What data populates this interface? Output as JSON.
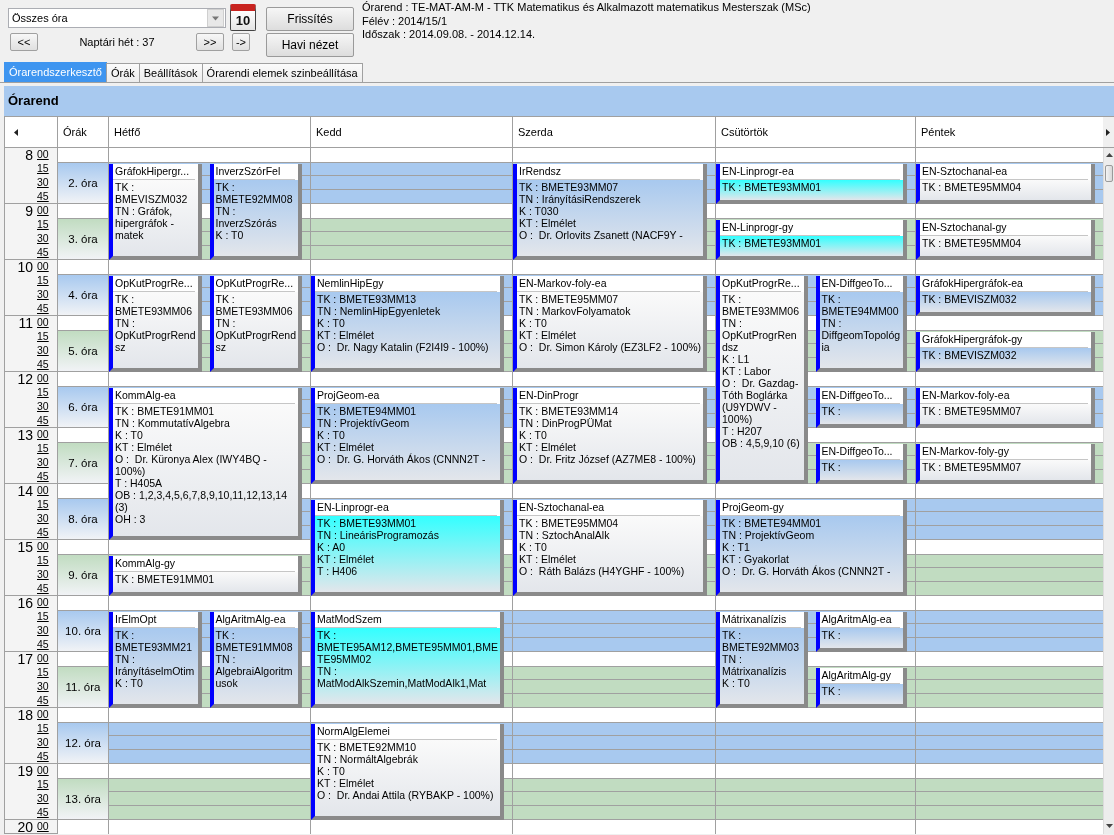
{
  "toolbar": {
    "filter_dropdown": {
      "value": "Összes óra"
    },
    "calendar_button": {
      "label": "10"
    },
    "prev_week_button": "<<",
    "week": "Naptári hét : 37",
    "next_week_button": ">>",
    "go_button": "->",
    "refresh_button": "Frissítés",
    "month_view_button": "Havi nézet"
  },
  "info": [
    "Órarend : TE-MAT-AM-M - TTK Matematikus és Alkalmazott matematikus Mesterszak (MSc)",
    "Félév : 2014/15/1",
    "Időszak : 2014.09.08. - 2014.12.14."
  ],
  "tabs": [
    {
      "label": "Órarendszerkesztő",
      "selected": true
    },
    {
      "label": "Órák",
      "selected": false
    },
    {
      "label": "Beállítások",
      "selected": false
    },
    {
      "label": "Órarendi elemek szinbeállítása",
      "selected": false
    }
  ],
  "panel": {
    "title": "Órarend"
  },
  "timetable": {
    "period_header": "Órák",
    "hours": [
      {
        "hour": "8",
        "minutes": [
          "00",
          "15",
          "30",
          "45"
        ],
        "period": {
          "label": "2. óra",
          "color": "#a8c9ef"
        }
      },
      {
        "hour": "9",
        "minutes": [
          "00",
          "15",
          "30",
          "45"
        ],
        "period": {
          "label": "3. óra",
          "color": "#c1dcc1"
        }
      },
      {
        "hour": "10",
        "minutes": [
          "00",
          "15",
          "30",
          "45"
        ],
        "period": {
          "label": "4. óra",
          "color": "#a8c9ef"
        }
      },
      {
        "hour": "11",
        "minutes": [
          "00",
          "15",
          "30",
          "45"
        ],
        "period": {
          "label": "5. óra",
          "color": "#c1dcc1"
        }
      },
      {
        "hour": "12",
        "minutes": [
          "00",
          "15",
          "30",
          "45"
        ],
        "period": {
          "label": "6. óra",
          "color": "#a8c9ef"
        }
      },
      {
        "hour": "13",
        "minutes": [
          "00",
          "15",
          "30",
          "45"
        ],
        "period": {
          "label": "7. óra",
          "color": "#c1dcc1"
        }
      },
      {
        "hour": "14",
        "minutes": [
          "00",
          "15",
          "30",
          "45"
        ],
        "period": {
          "label": "8. óra",
          "color": "#a8c9ef"
        }
      },
      {
        "hour": "15",
        "minutes": [
          "00",
          "15",
          "30",
          "45"
        ],
        "period": {
          "label": "9. óra",
          "color": "#c1dcc1"
        }
      },
      {
        "hour": "16",
        "minutes": [
          "00",
          "15",
          "30",
          "45"
        ],
        "period": {
          "label": "10. óra",
          "color": "#a8c9ef"
        }
      },
      {
        "hour": "17",
        "minutes": [
          "00",
          "15",
          "30",
          "45"
        ],
        "period": {
          "label": "11. óra",
          "color": "#c1dcc1"
        }
      },
      {
        "hour": "18",
        "minutes": [
          "00",
          "15",
          "30",
          "45"
        ],
        "period": {
          "label": "12. óra",
          "color": "#a8c9ef"
        }
      },
      {
        "hour": "19",
        "minutes": [
          "00",
          "15",
          "30",
          "45"
        ],
        "period": {
          "label": "13. óra",
          "color": "#c1dcc1"
        }
      },
      {
        "hour": "20",
        "minutes": [
          "00"
        ]
      }
    ],
    "days": [
      {
        "name": "Hétfő",
        "periods": [
          {
            "kind": "booked",
            "cards": [
              {
                "title": "GráfokHipergr...",
                "continued": false,
                "color": "#fafafa",
                "details": [
                  "TK : BMEVISZM032",
                  "TN : Gráfok, hipergráfok - matek"
                ]
              },
              {
                "title": "InverzSzórFel",
                "continued": false,
                "color": "#a8c9ef",
                "details": [
                  "TK : BMETE92MM08",
                  "TN : InverzSzórás",
                  "K : T0"
                ]
              }
            ]
          },
          {
            "kind": "booked",
            "cards": [
              {
                "continued": true
              },
              {
                "continued": true
              }
            ]
          },
          {
            "kind": "booked",
            "cards": [
              {
                "title": "OpKutProgrRe...",
                "continued": false,
                "color": "#fafafa",
                "details": [
                  "TK : BMETE93MM06",
                  "TN : OpKutProgrRendsz"
                ]
              },
              {
                "title": "OpKutProgrRe...",
                "continued": false,
                "color": "#fafafa",
                "details": [
                  "TK : BMETE93MM06",
                  "TN : OpKutProgrRendsz"
                ]
              }
            ]
          },
          {
            "kind": "booked",
            "cards": [
              {
                "continued": true
              },
              {
                "continued": true
              }
            ]
          },
          {
            "kind": "booked",
            "cards": [
              {
                "title": "KommAlg-ea",
                "continued": false,
                "color": "#fafafa",
                "details": [
                  "TK : BMETE91MM01",
                  "TN : KommutatívAlgebra",
                  "K : T0",
                  "KT : Elmélet",
                  "O :  Dr. Küronya Alex (IWY4BQ - 100%)",
                  "T : H405A",
                  "OB : 1,2,3,4,5,6,7,8,9,10,11,12,13,14 (3)",
                  "OH : 3"
                ]
              }
            ]
          },
          {
            "kind": "booked",
            "cards": [
              {
                "continued": true
              }
            ]
          },
          {
            "kind": "booked",
            "cards": [
              {
                "continued": true
              }
            ]
          },
          {
            "kind": "booked",
            "cards": [
              {
                "title": "KommAlg-gy",
                "continued": false,
                "color": "#fafafa",
                "details": [
                  "TK : BMETE91MM01"
                ]
              }
            ]
          },
          {
            "kind": "booked",
            "cards": [
              {
                "title": "IrElmOpt",
                "continued": false,
                "color": "#a8c9ef",
                "details": [
                  "TK : BMETE93MM21",
                  "TN : IrányításelmOtim",
                  "K : T0"
                ]
              },
              {
                "title": "AlgAritmAlg-ea",
                "continued": false,
                "color": "#a8c9ef",
                "details": [
                  "TK : BMETE91MM08",
                  "TN : AlgebraiAlgoritmusok"
                ]
              }
            ]
          },
          {
            "kind": "booked",
            "cards": [
              {
                "continued": true
              },
              {
                "continued": true
              }
            ]
          }
        ]
      },
      {
        "name": "Kedd",
        "periods": [
          {
            "kind": "free"
          },
          {
            "kind": "free"
          },
          {
            "kind": "booked",
            "cards": [
              {
                "title": "NemlinHipEgy",
                "continued": false,
                "color": "#a8c9ef",
                "details": [
                  "TK : BMETE93MM13",
                  "TN : NemlinHipEgyenletek",
                  "K : T0",
                  "KT : Elmélet",
                  "O :  Dr. Nagy Katalin (F2I4I9 - 100%)"
                ]
              }
            ]
          },
          {
            "kind": "booked",
            "cards": [
              {
                "continued": true
              }
            ]
          },
          {
            "kind": "booked",
            "cards": [
              {
                "title": "ProjGeom-ea",
                "continued": false,
                "color": "#a8c9ef",
                "details": [
                  "TK : BMETE94MM01",
                  "TN : ProjektívGeom",
                  "K : T0",
                  "KT : Elmélet",
                  "O :  Dr. G. Horváth Ákos (CNNN2T -"
                ]
              }
            ]
          },
          {
            "kind": "booked",
            "cards": [
              {
                "continued": true
              }
            ]
          },
          {
            "kind": "booked",
            "cards": [
              {
                "title": "EN-Linprogr-ea",
                "continued": false,
                "color": "#33ffff",
                "details": [
                  "TK : BMETE93MM01",
                  "TN : LineárisProgramozás",
                  "K : A0",
                  "KT : Elmélet",
                  "T : H406"
                ]
              }
            ]
          },
          {
            "kind": "booked",
            "cards": [
              {
                "continued": true
              }
            ]
          },
          {
            "kind": "booked",
            "cards": [
              {
                "title": "MatModSzem",
                "continued": false,
                "color": "#33ffff",
                "details": [
                  "TK : BMETE95AM12,BMETE95MM01,BMETE95MM02",
                  "TN : MatModAlkSzemin,MatModAlk1,Mat"
                ]
              }
            ]
          },
          {
            "kind": "booked",
            "cards": [
              {
                "continued": true
              }
            ]
          },
          {
            "kind": "booked",
            "cards": [
              {
                "title": "NormAlgElemei",
                "continued": false,
                "color": "#fafafa",
                "details": [
                  "TK : BMETE92MM10",
                  "TN : NormáltAlgebrák",
                  "K : T0",
                  "KT : Elmélet",
                  "O :  Dr. Andai Attila (RYBAKP - 100%)"
                ]
              }
            ]
          },
          {
            "kind": "booked",
            "cards": [
              {
                "continued": true
              }
            ]
          }
        ]
      },
      {
        "name": "Szerda",
        "periods": [
          {
            "kind": "booked",
            "cards": [
              {
                "title": "IrRendsz",
                "continued": false,
                "color": "#a8c9ef",
                "details": [
                  "TK : BMETE93MM07",
                  "TN : IrányításiRendszerek",
                  "K : T030",
                  "KT : Elmélet",
                  "O :  Dr. Orlovits Zsanett (NACF9Y -"
                ]
              }
            ]
          },
          {
            "kind": "booked",
            "cards": [
              {
                "continued": true
              }
            ]
          },
          {
            "kind": "booked",
            "cards": [
              {
                "title": "EN-Markov-foly-ea",
                "continued": false,
                "color": "#fafafa",
                "details": [
                  "TK : BMETE95MM07",
                  "TN : MarkovFolyamatok",
                  "K : T0",
                  "KT : Elmélet",
                  "O :  Dr. Simon Károly (EZ3LF2 - 100%)"
                ]
              }
            ]
          },
          {
            "kind": "booked",
            "cards": [
              {
                "continued": true
              }
            ]
          },
          {
            "kind": "booked",
            "cards": [
              {
                "title": "EN-DinProgr",
                "continued": false,
                "color": "#fafafa",
                "details": [
                  "TK : BMETE93MM14",
                  "TN : DinProgPÜMat",
                  "K : T0",
                  "KT : Elmélet",
                  "O :  Dr. Fritz József (AZ7ME8 - 100%)"
                ]
              }
            ]
          },
          {
            "kind": "booked",
            "cards": [
              {
                "continued": true
              }
            ]
          },
          {
            "kind": "booked",
            "cards": [
              {
                "title": "EN-Sztochanal-ea",
                "continued": false,
                "color": "#fafafa",
                "details": [
                  "TK : BMETE95MM04",
                  "TN : SztochAnalAlk",
                  "K : T0",
                  "KT : Elmélet",
                  "O :  Ráth Balázs (H4YGHF - 100%)"
                ]
              }
            ]
          },
          {
            "kind": "booked",
            "cards": [
              {
                "continued": true
              }
            ]
          }
        ]
      },
      {
        "name": "Csütörtök",
        "periods": [
          {
            "kind": "booked",
            "cards": [
              {
                "title": "EN-Linprogr-ea",
                "continued": false,
                "color": "#33ffff",
                "details": [
                  "TK : BMETE93MM01"
                ]
              }
            ]
          },
          {
            "kind": "booked",
            "cards": [
              {
                "title": "EN-Linprogr-gy",
                "continued": false,
                "color": "#33ffff",
                "details": [
                  "TK : BMETE93MM01"
                ]
              }
            ]
          },
          {
            "kind": "booked",
            "cards": [
              {
                "title": "OpKutProgrRe...",
                "continued": false,
                "color": "#fafafa",
                "details": [
                  "TK : BMETE93MM06",
                  "TN : OpKutProgrRendsz",
                  "K : L1",
                  "KT : Labor",
                  "O :  Dr. Gazdag-Tóth Boglárka (U9YDWV - 100%)",
                  "T : H207",
                  "OB : 4,5,9,10 (6)"
                ]
              },
              {
                "title": "EN-DiffgeoTo...",
                "continued": false,
                "color": "#a8c9ef",
                "details": [
                  "TK : BMETE94MM00",
                  "TN : DiffgeomTopológia"
                ]
              }
            ]
          },
          {
            "kind": "booked",
            "cards": [
              {
                "continued": true
              },
              {
                "continued": true
              }
            ]
          },
          {
            "kind": "booked",
            "cards": [
              {
                "continued": true
              },
              {
                "title": "EN-DiffgeoTo...",
                "continued": false,
                "color": "#a8c9ef",
                "details": [
                  "TK :"
                ]
              }
            ]
          },
          {
            "kind": "booked",
            "cards": [
              {
                "continued": true
              },
              {
                "title": "EN-DiffgeoTo...",
                "continued": false,
                "color": "#a8c9ef",
                "details": [
                  "TK :"
                ]
              }
            ]
          },
          {
            "kind": "booked",
            "cards": [
              {
                "title": "ProjGeom-gy",
                "continued": false,
                "color": "#a8c9ef",
                "details": [
                  "TK : BMETE94MM01",
                  "TN : ProjektívGeom",
                  "K : T1",
                  "KT : Gyakorlat",
                  "O :  Dr. G. Horváth Ákos (CNNN2T -"
                ]
              }
            ]
          },
          {
            "kind": "booked",
            "cards": [
              {
                "continued": true
              }
            ]
          },
          {
            "kind": "booked",
            "cards": [
              {
                "title": "Mátrixanalízis",
                "continued": false,
                "color": "#a8c9ef",
                "details": [
                  "TK : BMETE92MM03",
                  "TN : Mátrixanalízis",
                  "K : T0"
                ]
              },
              {
                "title": "AlgAritmAlg-ea",
                "continued": false,
                "color": "#a8c9ef",
                "details": [
                  "TK :"
                ]
              }
            ]
          },
          {
            "kind": "booked",
            "cards": [
              {
                "continued": true
              },
              {
                "title": "AlgAritmAlg-gy",
                "continued": false,
                "color": "#a8c9ef",
                "details": [
                  "TK :"
                ]
              }
            ]
          }
        ]
      },
      {
        "name": "Péntek",
        "periods": [
          {
            "kind": "booked",
            "cards": [
              {
                "title": "EN-Sztochanal-ea",
                "continued": false,
                "color": "#fafafa",
                "details": [
                  "TK : BMETE95MM04"
                ]
              }
            ]
          },
          {
            "kind": "booked",
            "cards": [
              {
                "title": "EN-Sztochanal-gy",
                "continued": false,
                "color": "#fafafa",
                "details": [
                  "TK : BMETE95MM04"
                ]
              }
            ]
          },
          {
            "kind": "booked",
            "cards": [
              {
                "title": "GráfokHipergráfok-ea",
                "continued": false,
                "color": "#a8c9ef",
                "details": [
                  "TK : BMEVISZM032"
                ]
              }
            ]
          },
          {
            "kind": "booked",
            "cards": [
              {
                "title": "GráfokHipergráfok-gy",
                "continued": false,
                "color": "#a8c9ef",
                "details": [
                  "TK : BMEVISZM032"
                ]
              }
            ]
          },
          {
            "kind": "booked",
            "cards": [
              {
                "title": "EN-Markov-foly-ea",
                "continued": false,
                "color": "#fafafa",
                "details": [
                  "TK : BMETE95MM07"
                ]
              }
            ]
          },
          {
            "kind": "booked",
            "cards": [
              {
                "title": "EN-Markov-foly-gy",
                "continued": false,
                "color": "#fafafa",
                "details": [
                  "TK : BMETE95MM07"
                ]
              }
            ]
          }
        ]
      }
    ]
  }
}
